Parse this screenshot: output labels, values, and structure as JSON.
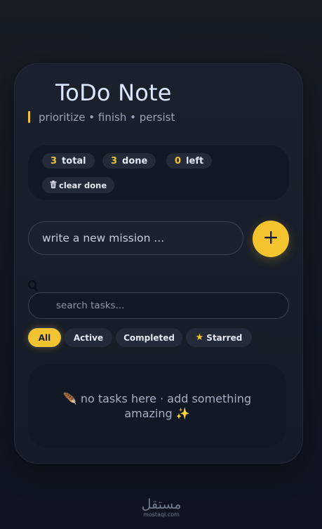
{
  "header": {
    "title": "ToDo Note",
    "subtitle": "prioritize • finish • persist"
  },
  "stats": {
    "total": {
      "count": "3",
      "label": "total"
    },
    "done": {
      "count": "3",
      "label": "done"
    },
    "left": {
      "count": "0",
      "label": "left"
    },
    "clear_icon": "trash-icon",
    "clear_label": "clear done"
  },
  "new_task": {
    "placeholder": "write a new mission ...",
    "add_icon": "plus-icon"
  },
  "search": {
    "icon": "search-icon",
    "placeholder": "search tasks..."
  },
  "filters": [
    {
      "label": "All",
      "active": true
    },
    {
      "label": "Active",
      "active": false
    },
    {
      "label": "Completed",
      "active": false
    },
    {
      "label": "Starred",
      "active": false,
      "icon": "star-icon"
    }
  ],
  "empty_state": {
    "leaf_icon": "🪶",
    "text": "no tasks here · add something amazing",
    "sparkle_icon": "✨"
  },
  "watermark": {
    "arabic": "مستقل",
    "domain": "mostaql.com"
  },
  "colors": {
    "accent": "#f4c430",
    "background": "#121722",
    "card": "#1b212c"
  }
}
